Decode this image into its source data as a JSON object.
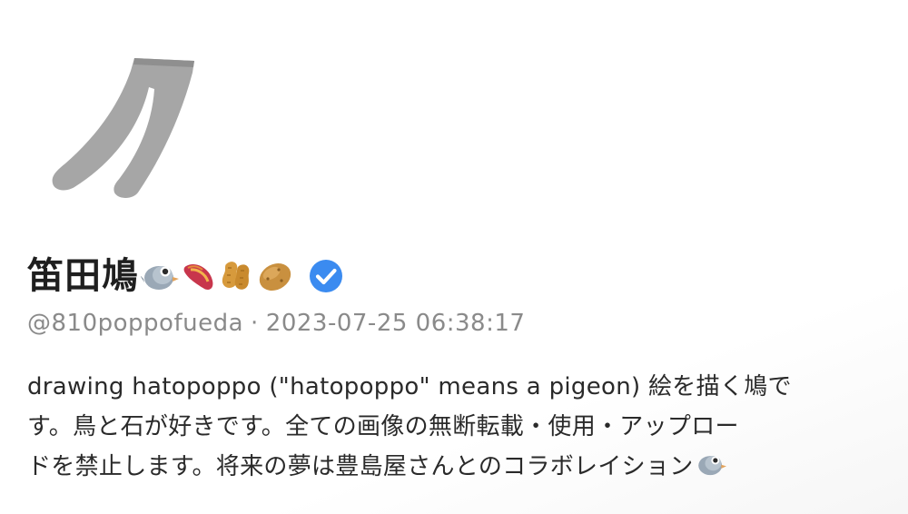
{
  "profile": {
    "display_name": "笛田鳩",
    "name_emojis": [
      "pigeon-emoji",
      "sweet-potato-emoji",
      "peanuts-emoji",
      "potato-emoji"
    ],
    "verified": true,
    "handle": "@810poppofueda",
    "separator": "·",
    "timestamp": "2023-07-25 06:38:17",
    "bio_lines": [
      "drawing hatopoppo (\"hatopoppo\" means a pigeon) 絵を描く鳩で",
      "す。鳥と石が好きです。全ての画像の無断転載・使用・アップロー",
      "ドを禁止します。将来の夢は豊島屋さんとのコラボレイション"
    ],
    "bio_trailing_emoji": "pigeon-emoji"
  },
  "colors": {
    "avatar_gray": "#a6a6a6",
    "verified_blue": "#1d9bf0",
    "meta_gray": "#8a8a8a",
    "text": "#2a2a2a"
  }
}
